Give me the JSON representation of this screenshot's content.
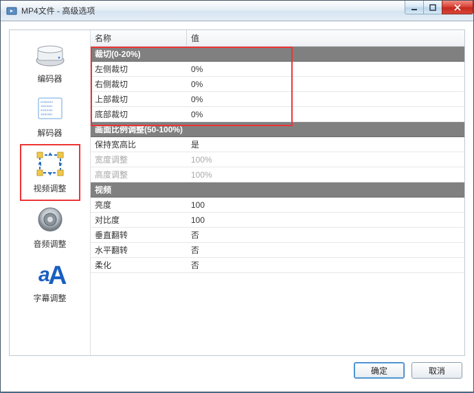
{
  "titlebar": {
    "title": "MP4文件 - 高级选项"
  },
  "sidebar": {
    "items": [
      {
        "label": "编码器"
      },
      {
        "label": "解码器"
      },
      {
        "label": "视频调整"
      },
      {
        "label": "音频调整"
      },
      {
        "label": "字幕调整"
      }
    ],
    "selected_index": 2
  },
  "table": {
    "header": {
      "name": "名称",
      "value": "值"
    },
    "sections": [
      {
        "title": "裁切(0-20%)",
        "rows": [
          {
            "name": "左侧裁切",
            "value": "0%"
          },
          {
            "name": "右侧裁切",
            "value": "0%"
          },
          {
            "name": "上部裁切",
            "value": "0%"
          },
          {
            "name": "底部裁切",
            "value": "0%"
          }
        ]
      },
      {
        "title": "画面比例调整(50-100%)",
        "rows": [
          {
            "name": "保持宽高比",
            "value": "是"
          },
          {
            "name": "宽度调整",
            "value": "100%",
            "disabled": true
          },
          {
            "name": "高度调整",
            "value": "100%",
            "disabled": true
          }
        ]
      },
      {
        "title": "视频",
        "rows": [
          {
            "name": "亮度",
            "value": "100"
          },
          {
            "name": "对比度",
            "value": "100"
          },
          {
            "name": "垂直翻转",
            "value": "否"
          },
          {
            "name": "水平翻转",
            "value": "否"
          },
          {
            "name": "柔化",
            "value": "否"
          }
        ]
      }
    ]
  },
  "footer": {
    "ok": "确定",
    "cancel": "取消"
  },
  "highlight": {
    "top_box": true,
    "sidebar_box_index": 2
  },
  "colors": {
    "accent_red": "#e33333",
    "section_gray": "#808080"
  }
}
